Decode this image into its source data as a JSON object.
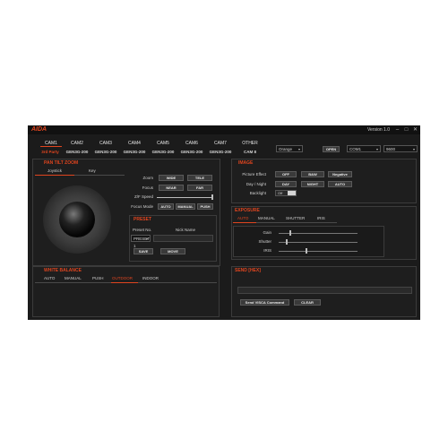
{
  "app": {
    "logo": "AIDA",
    "version": "Version 1.0"
  },
  "window_controls": {
    "minimize": "–",
    "maximize": "□",
    "close": "✕"
  },
  "cameras": [
    {
      "label": "CAM1",
      "model": "3rd Party"
    },
    {
      "label": "CAM2",
      "model": "GEN3G-200"
    },
    {
      "label": "CAM3",
      "model": "GEN3G-200"
    },
    {
      "label": "CAM4",
      "model": "GEN3G-200"
    },
    {
      "label": "CAM5",
      "model": "GEN3G-200"
    },
    {
      "label": "CAM6",
      "model": "GEN3G-200"
    },
    {
      "label": "CAM7",
      "model": "GEN3G-200"
    },
    {
      "label": "OTHER",
      "model": "CAM 8"
    }
  ],
  "theme_select": {
    "value": "Orange"
  },
  "connection": {
    "open_label": "OPEN",
    "port": "COM1",
    "baud": "9600"
  },
  "ptz": {
    "title": "PAN TILT ZOOM",
    "tabs": [
      "Joystick",
      "Key"
    ],
    "zoom": {
      "label": "Zoom",
      "wide": "WIDE",
      "tele": "TELE"
    },
    "focus": {
      "label": "Focus",
      "near": "NEAR",
      "far": "FAR"
    },
    "zf_speed": {
      "label": "Z/F Speed",
      "value": 1.0
    },
    "focus_mode": {
      "label": "Focus Mode",
      "auto": "AUTO",
      "manual": "MANUAL",
      "push": "PUSH"
    }
  },
  "preset": {
    "title": "PRESET",
    "preset_no_label": "Preset No.",
    "nick_name_label": "Nick Name",
    "selected": "PRESET 1",
    "save": "SAVE",
    "move": "MOVE"
  },
  "image": {
    "title": "IMAGE",
    "picture_effect": {
      "label": "Picture Effect",
      "options": [
        "OFF",
        "B&W",
        "Negative"
      ]
    },
    "day_night": {
      "label": "Day / Night",
      "options": [
        "DAY",
        "NIGHT",
        "AUTO"
      ]
    },
    "backlight": {
      "label": "Backlight",
      "state": "Off"
    }
  },
  "exposure": {
    "title": "EXPOSURE",
    "tabs": [
      "AUTO",
      "MANUAL",
      "SHUTTER",
      "IRIS"
    ],
    "gain": {
      "label": "Gain",
      "level": 0.15
    },
    "shutter": {
      "label": "Shutter",
      "level": 0.1
    },
    "iris": {
      "label": "IRIS",
      "level": 0.35
    }
  },
  "white_balance": {
    "title": "WHITE BALANCE",
    "tabs": [
      "AUTO",
      "MANUAL",
      "PUSH",
      "OUTDOOR",
      "INDOOR"
    ]
  },
  "send": {
    "title": "SEND [HEX]",
    "send_label": "Send VISCA Command",
    "clear_label": "CLEAR"
  }
}
